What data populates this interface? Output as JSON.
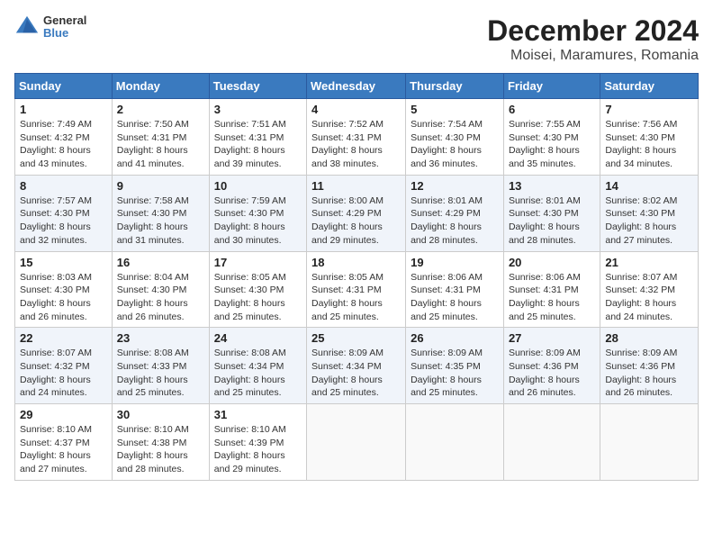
{
  "logo": {
    "line1": "General",
    "line2": "Blue"
  },
  "title": "December 2024",
  "subtitle": "Moisei, Maramures, Romania",
  "headers": [
    "Sunday",
    "Monday",
    "Tuesday",
    "Wednesday",
    "Thursday",
    "Friday",
    "Saturday"
  ],
  "weeks": [
    [
      {
        "day": "1",
        "sunrise": "7:49 AM",
        "sunset": "4:32 PM",
        "daylight": "8 hours and 43 minutes."
      },
      {
        "day": "2",
        "sunrise": "7:50 AM",
        "sunset": "4:31 PM",
        "daylight": "8 hours and 41 minutes."
      },
      {
        "day": "3",
        "sunrise": "7:51 AM",
        "sunset": "4:31 PM",
        "daylight": "8 hours and 39 minutes."
      },
      {
        "day": "4",
        "sunrise": "7:52 AM",
        "sunset": "4:31 PM",
        "daylight": "8 hours and 38 minutes."
      },
      {
        "day": "5",
        "sunrise": "7:54 AM",
        "sunset": "4:30 PM",
        "daylight": "8 hours and 36 minutes."
      },
      {
        "day": "6",
        "sunrise": "7:55 AM",
        "sunset": "4:30 PM",
        "daylight": "8 hours and 35 minutes."
      },
      {
        "day": "7",
        "sunrise": "7:56 AM",
        "sunset": "4:30 PM",
        "daylight": "8 hours and 34 minutes."
      }
    ],
    [
      {
        "day": "8",
        "sunrise": "7:57 AM",
        "sunset": "4:30 PM",
        "daylight": "8 hours and 32 minutes."
      },
      {
        "day": "9",
        "sunrise": "7:58 AM",
        "sunset": "4:30 PM",
        "daylight": "8 hours and 31 minutes."
      },
      {
        "day": "10",
        "sunrise": "7:59 AM",
        "sunset": "4:30 PM",
        "daylight": "8 hours and 30 minutes."
      },
      {
        "day": "11",
        "sunrise": "8:00 AM",
        "sunset": "4:29 PM",
        "daylight": "8 hours and 29 minutes."
      },
      {
        "day": "12",
        "sunrise": "8:01 AM",
        "sunset": "4:29 PM",
        "daylight": "8 hours and 28 minutes."
      },
      {
        "day": "13",
        "sunrise": "8:01 AM",
        "sunset": "4:30 PM",
        "daylight": "8 hours and 28 minutes."
      },
      {
        "day": "14",
        "sunrise": "8:02 AM",
        "sunset": "4:30 PM",
        "daylight": "8 hours and 27 minutes."
      }
    ],
    [
      {
        "day": "15",
        "sunrise": "8:03 AM",
        "sunset": "4:30 PM",
        "daylight": "8 hours and 26 minutes."
      },
      {
        "day": "16",
        "sunrise": "8:04 AM",
        "sunset": "4:30 PM",
        "daylight": "8 hours and 26 minutes."
      },
      {
        "day": "17",
        "sunrise": "8:05 AM",
        "sunset": "4:30 PM",
        "daylight": "8 hours and 25 minutes."
      },
      {
        "day": "18",
        "sunrise": "8:05 AM",
        "sunset": "4:31 PM",
        "daylight": "8 hours and 25 minutes."
      },
      {
        "day": "19",
        "sunrise": "8:06 AM",
        "sunset": "4:31 PM",
        "daylight": "8 hours and 25 minutes."
      },
      {
        "day": "20",
        "sunrise": "8:06 AM",
        "sunset": "4:31 PM",
        "daylight": "8 hours and 25 minutes."
      },
      {
        "day": "21",
        "sunrise": "8:07 AM",
        "sunset": "4:32 PM",
        "daylight": "8 hours and 24 minutes."
      }
    ],
    [
      {
        "day": "22",
        "sunrise": "8:07 AM",
        "sunset": "4:32 PM",
        "daylight": "8 hours and 24 minutes."
      },
      {
        "day": "23",
        "sunrise": "8:08 AM",
        "sunset": "4:33 PM",
        "daylight": "8 hours and 25 minutes."
      },
      {
        "day": "24",
        "sunrise": "8:08 AM",
        "sunset": "4:34 PM",
        "daylight": "8 hours and 25 minutes."
      },
      {
        "day": "25",
        "sunrise": "8:09 AM",
        "sunset": "4:34 PM",
        "daylight": "8 hours and 25 minutes."
      },
      {
        "day": "26",
        "sunrise": "8:09 AM",
        "sunset": "4:35 PM",
        "daylight": "8 hours and 25 minutes."
      },
      {
        "day": "27",
        "sunrise": "8:09 AM",
        "sunset": "4:36 PM",
        "daylight": "8 hours and 26 minutes."
      },
      {
        "day": "28",
        "sunrise": "8:09 AM",
        "sunset": "4:36 PM",
        "daylight": "8 hours and 26 minutes."
      }
    ],
    [
      {
        "day": "29",
        "sunrise": "8:10 AM",
        "sunset": "4:37 PM",
        "daylight": "8 hours and 27 minutes."
      },
      {
        "day": "30",
        "sunrise": "8:10 AM",
        "sunset": "4:38 PM",
        "daylight": "8 hours and 28 minutes."
      },
      {
        "day": "31",
        "sunrise": "8:10 AM",
        "sunset": "4:39 PM",
        "daylight": "8 hours and 29 minutes."
      },
      null,
      null,
      null,
      null
    ]
  ],
  "labels": {
    "sunrise": "Sunrise:",
    "sunset": "Sunset:",
    "daylight": "Daylight:"
  }
}
